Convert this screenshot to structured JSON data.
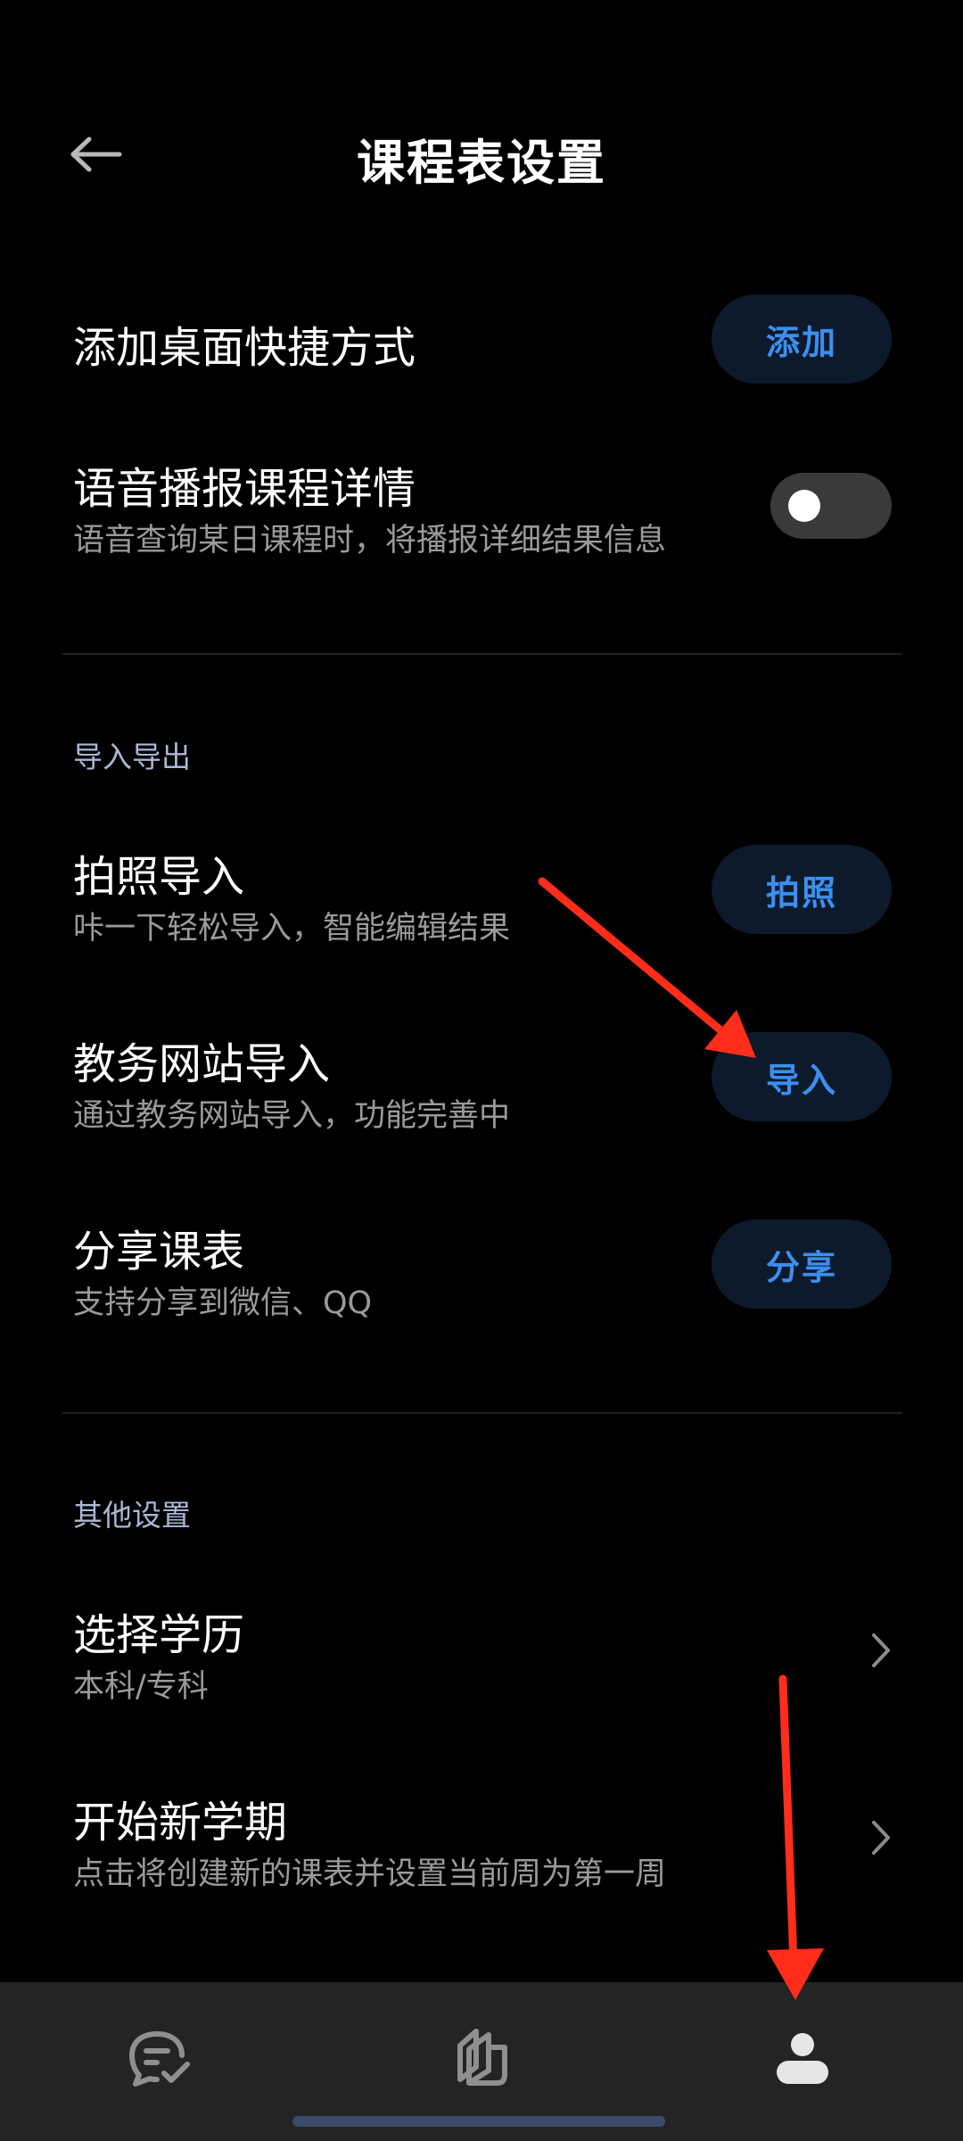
{
  "header": {
    "title": "课程表设置"
  },
  "shortcut": {
    "title": "添加桌面快捷方式",
    "button_label": "添加"
  },
  "voice": {
    "title": "语音播报课程详情",
    "subtitle": "语音查询某日课程时，将播报详细结果信息",
    "toggle_on": false
  },
  "import_export": {
    "section_title": "导入导出",
    "items": [
      {
        "title": "拍照导入",
        "subtitle": "咔一下轻松导入，智能编辑结果",
        "button_label": "拍照"
      },
      {
        "title": "教务网站导入",
        "subtitle": "通过教务网站导入，功能完善中",
        "button_label": "导入"
      },
      {
        "title": "分享课表",
        "subtitle": "支持分享到微信、QQ",
        "button_label": "分享"
      }
    ]
  },
  "other": {
    "section_title": "其他设置",
    "items": [
      {
        "title": "选择学历",
        "subtitle": "本科/专科"
      },
      {
        "title": "开始新学期",
        "subtitle": "点击将创建新的课表并设置当前周为第一周"
      }
    ]
  },
  "bottom_nav": {
    "items": [
      {
        "icon": "chat-check-icon"
      },
      {
        "icon": "books-icon"
      },
      {
        "icon": "person-icon"
      }
    ]
  },
  "colors": {
    "background": "#000000",
    "accent": "#3b8ff0",
    "pill_bg": "#0c1a2c",
    "annotation": "#ff2d1a"
  }
}
